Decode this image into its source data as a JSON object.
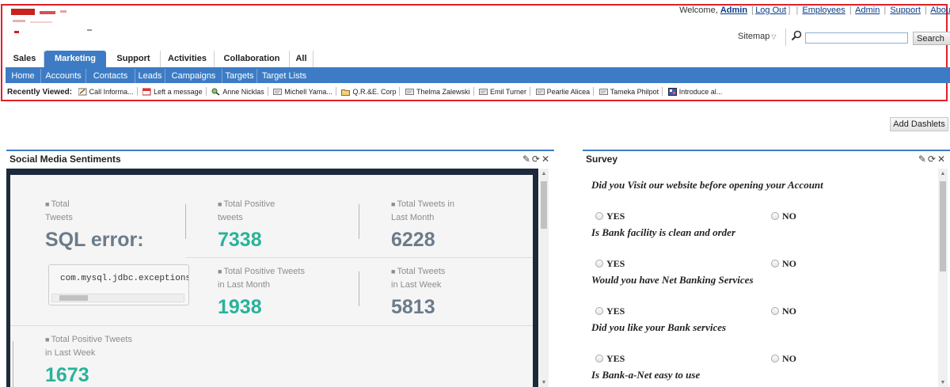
{
  "header": {
    "welcome_text": "Welcome,",
    "user_name": "Admin",
    "logout": "Log Out",
    "links": [
      "Employees",
      "Admin",
      "Support",
      "About"
    ],
    "sitemap": "Sitemap",
    "search_placeholder": "",
    "search_button": "Search"
  },
  "tabs": [
    {
      "label": "Sales",
      "active": false
    },
    {
      "label": "Marketing",
      "active": true
    },
    {
      "label": "Support",
      "active": false
    },
    {
      "label": "Activities",
      "active": false
    },
    {
      "label": "Collaboration",
      "active": false
    },
    {
      "label": "All",
      "active": false
    }
  ],
  "subnav": [
    "Home",
    "Accounts",
    "Contacts",
    "Leads",
    "Campaigns",
    "Targets",
    "Target Lists"
  ],
  "recent": {
    "label": "Recently Viewed:",
    "items": [
      {
        "icon": "call-icon",
        "text": "Call Informa..."
      },
      {
        "icon": "calendar-icon",
        "text": "Left a message"
      },
      {
        "icon": "contact-search-icon",
        "text": "Anne Nicklas"
      },
      {
        "icon": "card-icon",
        "text": "Michell Yama..."
      },
      {
        "icon": "folder-icon",
        "text": "Q.R.&E. Corp"
      },
      {
        "icon": "card-icon",
        "text": "Thelma Zalewski"
      },
      {
        "icon": "card-icon",
        "text": "Emil Turner"
      },
      {
        "icon": "card-icon",
        "text": "Pearlie Alicea"
      },
      {
        "icon": "card-icon",
        "text": "Tameka Philpot"
      },
      {
        "icon": "document-icon",
        "text": "Introduce al..."
      }
    ]
  },
  "add_dashlets": "Add Dashlets",
  "social": {
    "title": "Social Media Sentiments",
    "cards": [
      {
        "label1": "Total",
        "label2": "Tweets",
        "value": "SQL error:",
        "color": "#6b7b8a"
      },
      {
        "label1": "Total Positive",
        "label2": "tweets",
        "value": "7338",
        "color": "#28b39a"
      },
      {
        "label1": "Total Tweets in",
        "label2": "Last Month",
        "value": "6228",
        "color": "#6b7b8a"
      },
      {
        "label1": "Total Positive Tweets",
        "label2": "in Last Month",
        "value": "1938",
        "color": "#28b39a"
      },
      {
        "label1": "Total Tweets",
        "label2": "in Last Week",
        "value": "5813",
        "color": "#6b7b8a"
      },
      {
        "label1": "Total Positive Tweets",
        "label2": "in Last Week",
        "value": "1673",
        "color": "#28b39a"
      }
    ],
    "error_code": "com.mysql.jdbc.exceptions"
  },
  "survey": {
    "title": "Survey",
    "yes": "YES",
    "no": "NO",
    "questions": [
      "Did you Visit our website before opening your Account",
      "Is Bank facility is clean and order",
      "Would you have Net Banking Services",
      "Did you like your Bank services",
      "Is Bank-a-Net easy to use"
    ]
  },
  "colors": {
    "accent": "#3d7cc5",
    "highlight_border": "#e0202a",
    "green_value": "#28b39a",
    "grey_value": "#6b7b8a"
  }
}
